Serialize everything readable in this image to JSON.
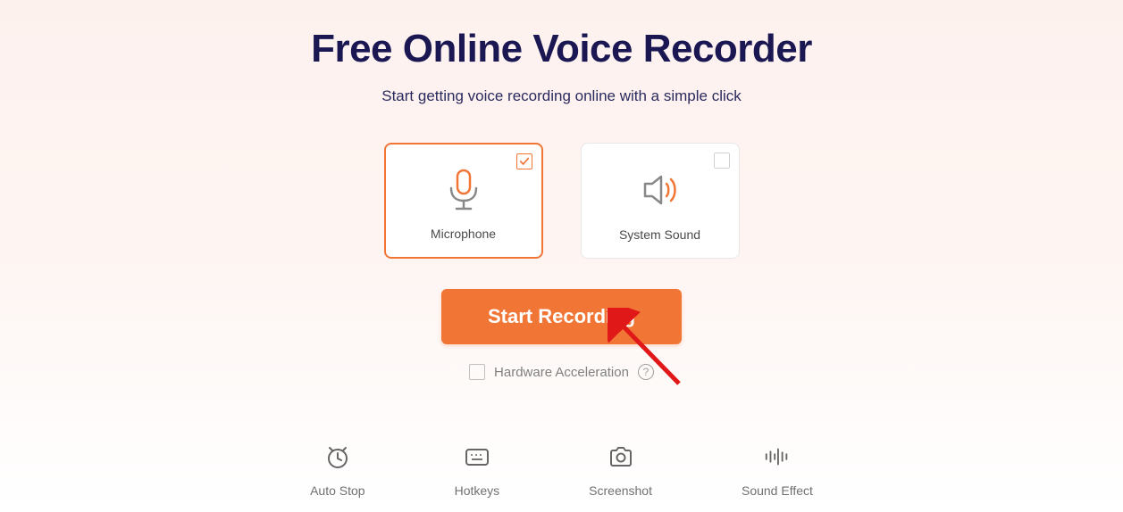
{
  "header": {
    "title": "Free Online Voice Recorder",
    "subtitle": "Start getting voice recording online with a simple click"
  },
  "options": {
    "microphone": {
      "label": "Microphone",
      "selected": true
    },
    "system_sound": {
      "label": "System Sound",
      "selected": false
    }
  },
  "start_button": "Start Recording",
  "hardware_accel": {
    "label": "Hardware Acceleration",
    "checked": false
  },
  "features": {
    "auto_stop": "Auto Stop",
    "hotkeys": "Hotkeys",
    "screenshot": "Screenshot",
    "sound_effect": "Sound Effect"
  }
}
